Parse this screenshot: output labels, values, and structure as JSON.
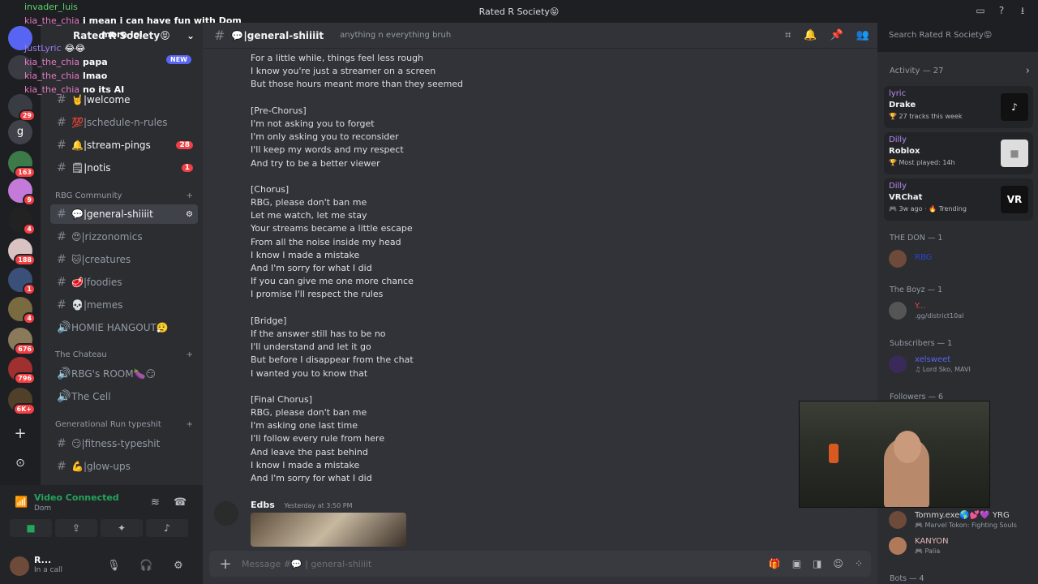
{
  "window": {
    "title": "Rated R Society😝"
  },
  "overlay_chat": [
    {
      "user": "invader_luis",
      "msg": ""
    },
    {
      "user": "kia_the_chia",
      "msg": "i mean i can have fun with Dom"
    },
    {
      "user": "",
      "msg": "more lol"
    },
    {
      "user": "JustLyric",
      "msg": "😂😂"
    },
    {
      "user": "kia_the_chia",
      "msg": "papa"
    },
    {
      "user": "kia_the_chia",
      "msg": "lmao"
    },
    {
      "user": "kia_the_chia",
      "msg": "no its AI"
    }
  ],
  "guild": {
    "name": "Rated R Society😝",
    "new_badge": "NEW"
  },
  "servers": [
    {
      "badge": "29"
    },
    {
      "badge": ""
    },
    {
      "badge": "163"
    },
    {
      "badge": "9"
    },
    {
      "badge": "4"
    },
    {
      "badge": "188"
    },
    {
      "badge": "1"
    },
    {
      "badge": "4"
    },
    {
      "badge": "676"
    },
    {
      "badge": "796"
    },
    {
      "badge": "6K+"
    }
  ],
  "channels": [
    {
      "name": "🤘|welcome",
      "badge": ""
    },
    {
      "name": "💯|schedule-n-rules",
      "badge": ""
    },
    {
      "name": "🔔|stream-pings",
      "badge": "28"
    },
    {
      "name": "🗒|notis",
      "badge": "1"
    }
  ],
  "categories": {
    "rbg": "RBG Community",
    "chateau": "The Chateau",
    "genrun": "Generational Run typeshit"
  },
  "rbg_channels": [
    {
      "name": "💬|general-shiiiit"
    },
    {
      "name": "😍|rizzonomics"
    },
    {
      "name": "🐱|creatures"
    },
    {
      "name": "🥩|foodies"
    },
    {
      "name": "💀|memes"
    }
  ],
  "voice_channels": [
    {
      "name": "HOMIE HANGOUT😮‍💨"
    },
    {
      "name": "RBG's ROOM🍆😏"
    },
    {
      "name": "The Cell"
    }
  ],
  "genrun_channels": [
    {
      "name": "😏|fitness-typeshit"
    },
    {
      "name": "💪|glow-ups"
    }
  ],
  "voice": {
    "title": "Video Connected",
    "sub": "Dom"
  },
  "user": {
    "name": "R...",
    "status": "In a call"
  },
  "header": {
    "channel": "💬|general-shiiiit",
    "topic": "anything n everything bruh",
    "search": "Search Rated R Society😝"
  },
  "lyrics": [
    "For a little while, things feel less rough",
    "I know you're just a streamer on a screen",
    "But those hours meant more than they seemed",
    "",
    "[Pre-Chorus]",
    "I'm not asking you to forget",
    "I'm only asking you to reconsider",
    "I'll keep my words and my respect",
    "And try to be a better viewer",
    "",
    "[Chorus]",
    "RBG, please don't ban me",
    "Let me watch, let me stay",
    "Your streams became a little escape",
    "From all the noise inside my head",
    "I know I made a mistake",
    "And I'm sorry for what I did",
    "If you can give me one more chance",
    "I promise I'll respect the rules",
    "",
    "[Bridge]",
    "If the answer still has to be no",
    "I'll understand and let it go",
    "But before I disappear from the chat",
    "I wanted you to know that",
    "",
    "[Final Chorus]",
    "RBG, please don't ban me",
    "I'm asking one last time",
    "I'll follow every rule from here",
    "And leave the past behind",
    "I know I made a mistake",
    "And I'm sorry for what I did"
  ],
  "message": {
    "author": "Edbs",
    "time": "Yesterday at 3:50 PM"
  },
  "composer": {
    "placeholder": "Message #💬 | general-shiiiit"
  },
  "activity": {
    "title": "Activity — 27",
    "items": [
      {
        "who": "lyric",
        "what": "Drake",
        "detail": "🏆 27 tracks this week",
        "thumb": "♪"
      },
      {
        "who": "Dilly",
        "what": "Roblox",
        "detail": "🏆 Most played: 14h",
        "thumb": "■"
      },
      {
        "who": "Dilly",
        "what": "VRChat",
        "detail": "🎮 3w ago · 🔥 Trending",
        "thumb": "VR"
      }
    ]
  },
  "member_groups": [
    {
      "title": "THE DON — 1",
      "name": "RBG",
      "status": ""
    },
    {
      "title": "The Boyz — 1",
      "name": "Y...",
      "status": ".gg/district10al"
    },
    {
      "title": "Subscribers — 1",
      "name": "xelsweet",
      "status": "♫ Lord Sko, MAVI"
    },
    {
      "title": "Followers — 6",
      "name": "",
      "status": ""
    }
  ],
  "followers": [
    {
      "name": "Tommy.exe🌎💕💜 YRG",
      "status": "🎮 Marvel Tokon: Fighting Souls"
    },
    {
      "name": "KANYON",
      "status": "🎮 Palia"
    }
  ],
  "bots": "Bots — 4",
  "colors": {
    "accent_green": "#23a55a",
    "badge_red": "#f23f43",
    "chat_user": "#e879c4"
  }
}
